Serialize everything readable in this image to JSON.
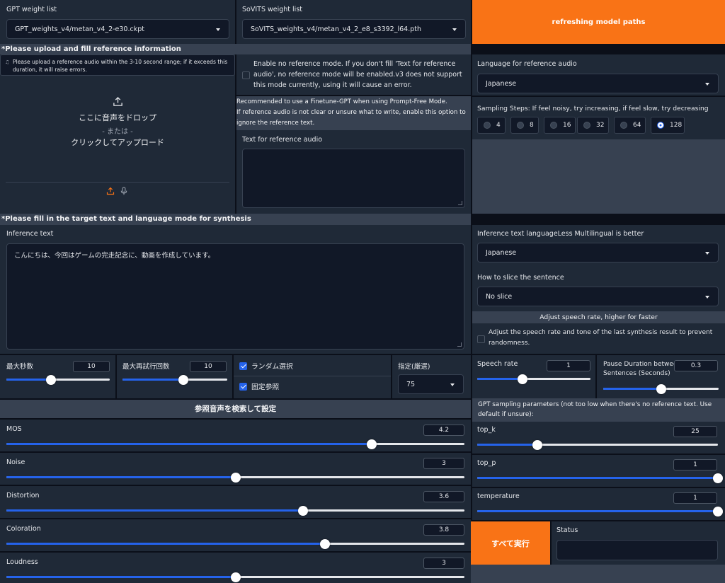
{
  "gpt": {
    "label": "GPT weight list",
    "value": "GPT_weights_v4/metan_v4_2-e30.ckpt"
  },
  "sovits": {
    "label": "SoVITS weight list",
    "value": "SoVITS_weights_v4/metan_v4_2_e8_s3392_l64.pth"
  },
  "refresh_button": "refreshing model paths",
  "ref_section": {
    "title": "*Please upload and fill reference information",
    "upload_hint": "Please upload a reference audio within the 3-10 second range; if it exceeds this duration, it will raise errors.",
    "drop_text": "ここに音声をドロップ",
    "or_text": "- または -",
    "click_text": "クリックしてアップロード"
  },
  "no_ref": {
    "text": "Enable no reference mode. If you don't fill 'Text for reference audio', no reference mode will be enabled.v3 does not support this mode currently, using it will cause an error.",
    "checked": false
  },
  "ref_note": {
    "line1": "Recommended to use a Finetune-GPT when using Prompt-Free Mode.",
    "line2": "If reference audio is not clear or unsure what to write, enable this option to ignore the reference text."
  },
  "ref_text": {
    "label": "Text for reference audio",
    "value": ""
  },
  "ref_lang": {
    "label": "Language for reference audio",
    "value": "Japanese"
  },
  "sampling": {
    "label": "Sampling Steps: If feel noisy, try increasing, if feel slow, try decreasing",
    "options": [
      "4",
      "8",
      "16",
      "32",
      "64",
      "128"
    ],
    "selected": "128"
  },
  "target_section": {
    "title": "*Please fill in the target text and language mode for synthesis"
  },
  "inference": {
    "label": "Inference text",
    "value": "こんにちは、今回はゲームの完走記念に、動画を作成しています。"
  },
  "infer_lang": {
    "label": "Inference text languageLess Multilingual is better",
    "value": "Japanese"
  },
  "slice": {
    "label": "How to slice the sentence",
    "value": "No slice"
  },
  "speed_header": "Adjust speech rate, higher for faster",
  "adjust_last": {
    "text": "Adjust the speech rate and tone of the last synthesis result to prevent randomness.",
    "checked": false
  },
  "max_sec": {
    "label": "最大秒数",
    "value": "10",
    "fraction": 0.43
  },
  "max_retry": {
    "label": "最大再試行回数",
    "value": "10",
    "fraction": 0.58
  },
  "random_select": {
    "label": "ランダム選択",
    "checked": true
  },
  "fixed_ref": {
    "label": "固定参照",
    "checked": true
  },
  "designated": {
    "label": "指定(厳選)",
    "value": "75"
  },
  "speech_rate": {
    "label": "Speech rate",
    "value": "1",
    "fraction": 0.4
  },
  "pause": {
    "label_line1": "Pause Duration between",
    "label_line2": "Sentences (Seconds)",
    "value": "0.3",
    "fraction": 0.5
  },
  "search_header": "参照音声を検索して設定",
  "metrics": [
    {
      "label": "MOS",
      "value": "4.2",
      "fraction": 0.797
    },
    {
      "label": "Noise",
      "value": "3",
      "fraction": 0.5
    },
    {
      "label": "Distortion",
      "value": "3.6",
      "fraction": 0.647
    },
    {
      "label": "Coloration",
      "value": "3.8",
      "fraction": 0.696
    },
    {
      "label": "Loudness",
      "value": "3",
      "fraction": 0.5
    }
  ],
  "gpt_sampling_header": "GPT sampling parameters (not too low when there's no reference text. Use default if unsure):",
  "gpt_params": [
    {
      "label": "top_k",
      "value": "25",
      "fraction": 0.25
    },
    {
      "label": "top_p",
      "value": "1",
      "fraction": 1.0
    },
    {
      "label": "temperature",
      "value": "1",
      "fraction": 1.0
    }
  ],
  "run_all_button": "すべて実行",
  "status": {
    "label": "Status",
    "value": ""
  },
  "colors": {
    "accent": "#f97316",
    "slider": "#2563eb",
    "panel": "#1f2937",
    "header": "#374151"
  }
}
